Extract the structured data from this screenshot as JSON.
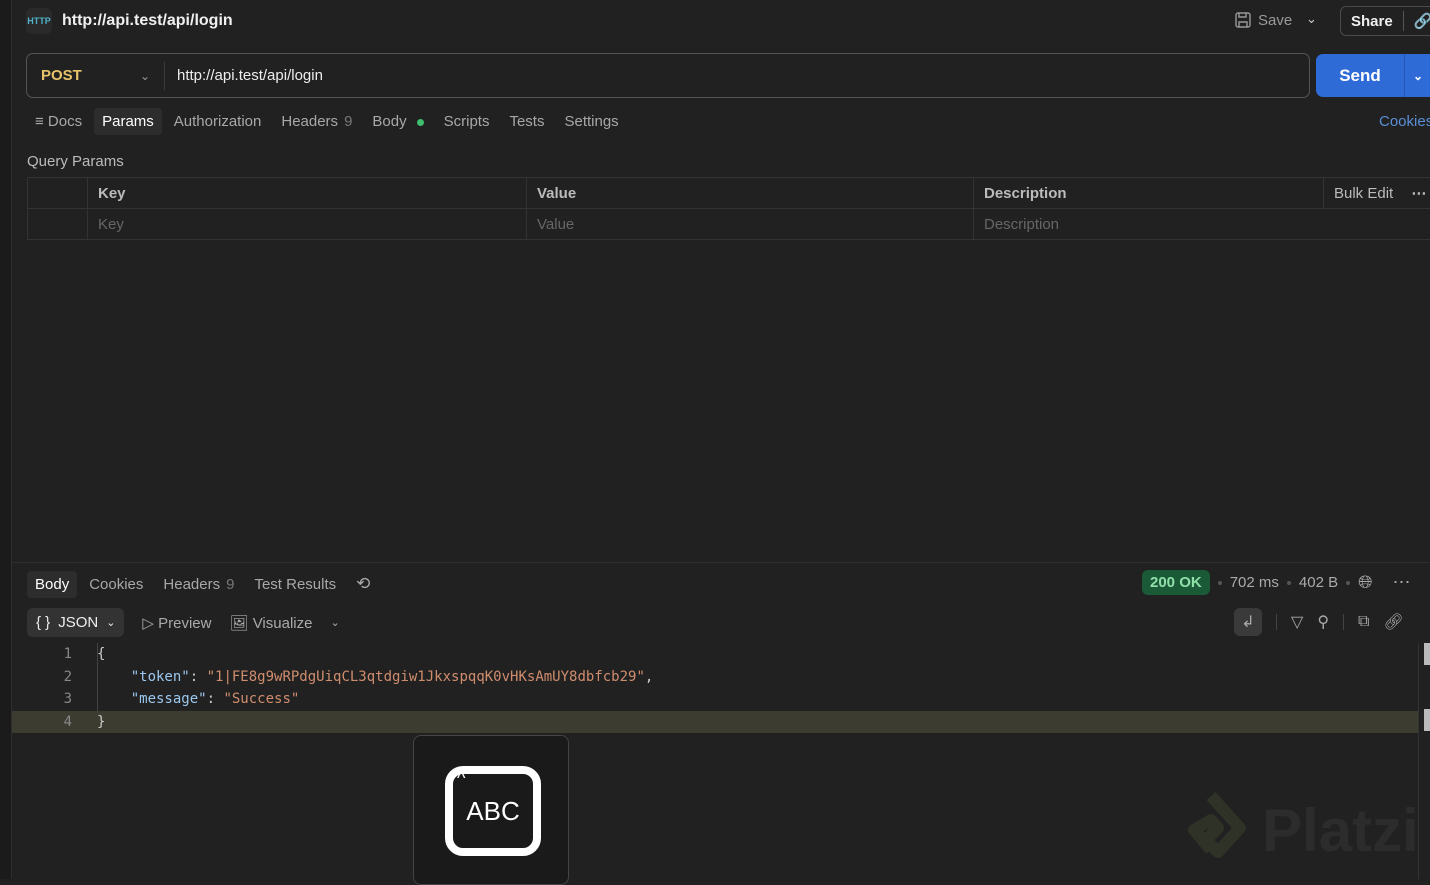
{
  "header": {
    "icon_text": "HTTP",
    "title": "http://api.test/api/login",
    "save_label": "Save",
    "share_label": "Share"
  },
  "request": {
    "method": "POST",
    "url": "http://api.test/api/login",
    "send_label": "Send"
  },
  "tabs": [
    {
      "label": "Docs"
    },
    {
      "label": "Params"
    },
    {
      "label": "Authorization"
    },
    {
      "label": "Headers",
      "count": "9"
    },
    {
      "label": "Body"
    },
    {
      "label": "Scripts"
    },
    {
      "label": "Tests"
    },
    {
      "label": "Settings"
    }
  ],
  "cookies_link": "Cookies",
  "query_params": {
    "title": "Query Params",
    "columns": [
      "Key",
      "Value",
      "Description"
    ],
    "bulk_edit": "Bulk Edit",
    "placeholders": [
      "Key",
      "Value",
      "Description"
    ]
  },
  "response": {
    "tabs": [
      {
        "label": "Body"
      },
      {
        "label": "Cookies"
      },
      {
        "label": "Headers",
        "count": "9"
      },
      {
        "label": "Test Results"
      }
    ],
    "status": "200 OK",
    "time": "702 ms",
    "size": "402 B",
    "format": "JSON",
    "preview": "Preview",
    "visualize": "Visualize",
    "lines": [
      "1",
      "2",
      "3",
      "4"
    ],
    "body": {
      "open": "{",
      "token_key": "\"token\"",
      "token_value": "\"1|FE8g9wRPdgUiqCL3qtdgiw1JkxspqqK0vHKsAmUY8dbfcb29\"",
      "message_key": "\"message\"",
      "message_value": "\"Success\"",
      "close": "}"
    }
  },
  "popup": {
    "text": "ABC"
  },
  "watermark": "Platzi"
}
